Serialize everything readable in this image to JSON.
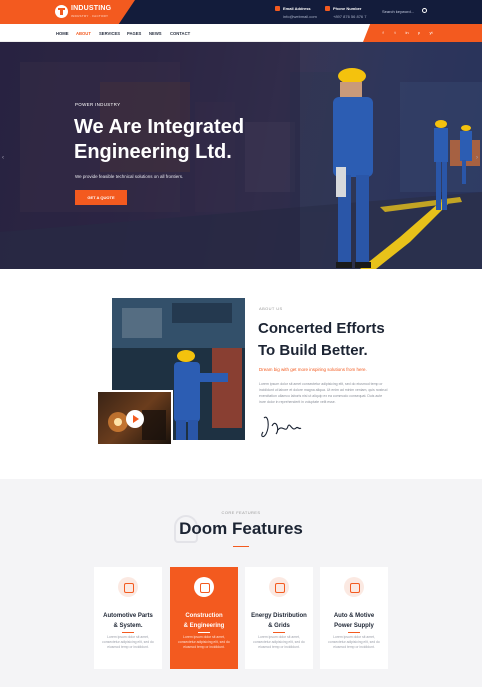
{
  "brand": {
    "name": "INDUSTING",
    "tagline": "INDUSTRY · FACTORY",
    "accent": "#f35a1f",
    "dark": "#131c3b"
  },
  "topbar": {
    "email_label": "Email Address",
    "email_value": "info@webmail.com",
    "phone_label": "Phone Number",
    "phone_value": "+897 876 56 876 7",
    "search_placeholder": "Search keyword..."
  },
  "nav": {
    "items": [
      "HOME",
      "ABOUT",
      "SERVICES",
      "PAGES",
      "NEWS",
      "CONTACT"
    ],
    "active": "ABOUT"
  },
  "social": [
    "f",
    "t",
    "in",
    "p",
    "yt"
  ],
  "hero": {
    "kicker": "POWER INDUSTRY",
    "title_line1": "We Are Integrated",
    "title_line2": "Engineering Ltd.",
    "description": "We provide feasible technical solutions on all frontiers.",
    "button": "GET A QUOTE"
  },
  "about": {
    "kicker": "ABOUT US",
    "title_line1": "Concerted Efforts",
    "title_line2": "To Build Better.",
    "subtitle": "Dream big with get more inspiring solutions from here.",
    "body": "Lorem ipsum dolor sit amet consectetur adipisicing elit, sed do eiusmod temp or incididunt ut labore et dolore magna aliqua. Ut enim ad minim veniam, quis nostrud exercitation ullamco laboris nisi ut aliquip ex ea commodo consequat. Duis aute irure dolor in reprehenderit in voluptate velit esse."
  },
  "features": {
    "kicker": "CORE FEATURES",
    "title": "Doom Features",
    "cards": [
      {
        "title_line1": "Automotive Parts",
        "title_line2": "& System.",
        "desc": "Lorem ipsum dolor sit amet, consectetur adipisicing elit, sed do eiusmod temp or incididunt."
      },
      {
        "title_line1": "Construction",
        "title_line2": "& Engineering",
        "desc": "Lorem ipsum dolor sit amet, consectetur adipisicing elit, sed do eiusmod temp or incididunt."
      },
      {
        "title_line1": "Energy Distribution",
        "title_line2": "& Grids",
        "desc": "Lorem ipsum dolor sit amet, consectetur adipisicing elit, sed do eiusmod temp or incididunt."
      },
      {
        "title_line1": "Auto & Motive",
        "title_line2": "Power Supply",
        "desc": "Lorem ipsum dolor sit amet, consectetur adipisicing elit, sed do eiusmod temp or incididunt."
      }
    ],
    "active_index": 1
  }
}
